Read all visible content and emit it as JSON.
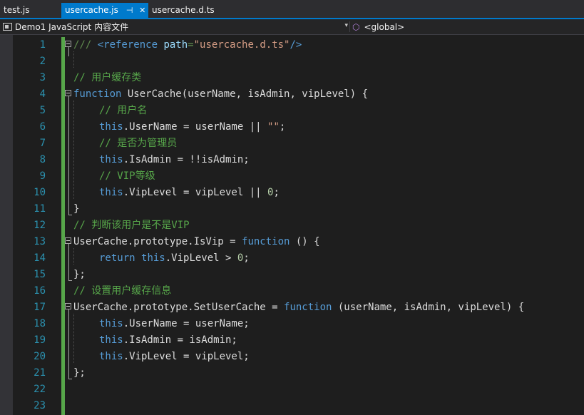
{
  "tabs": [
    {
      "label": "test.js",
      "active": false
    },
    {
      "label": "usercache.js",
      "active": true,
      "pin_icon": "⊣",
      "close_icon": "✕"
    },
    {
      "label": "usercache.d.ts",
      "active": false
    }
  ],
  "navbar": {
    "project": "Demo1 JavaScript 内容文件",
    "scope": "<global>"
  },
  "editor": {
    "line_numbers": [
      "1",
      "2",
      "3",
      "4",
      "5",
      "6",
      "7",
      "8",
      "9",
      "10",
      "11",
      "12",
      "13",
      "14",
      "15",
      "16",
      "17",
      "18",
      "19",
      "20",
      "21",
      "22",
      "23"
    ],
    "l1": {
      "a": "/// ",
      "b": "<reference",
      "c": " path",
      "d": "=",
      "e": "\"usercache.d.ts\"",
      "f": "/>"
    },
    "l3": "// 用户缓存类",
    "l4": {
      "kw": "function",
      "rest": " UserCache(userName, isAdmin, vipLevel) {"
    },
    "l5": "// 用户名",
    "l6": {
      "kw": "this",
      "mid": ".UserName = userName || ",
      "str": "\"\"",
      "end": ";"
    },
    "l7": "// 是否为管理员",
    "l8": {
      "kw": "this",
      "rest": ".IsAdmin = !!isAdmin;"
    },
    "l9": "// VIP等级",
    "l10": {
      "kw": "this",
      "mid": ".VipLevel = vipLevel || ",
      "num": "0",
      "end": ";"
    },
    "l11": "}",
    "l12": "// 判断该用户是不是VIP",
    "l13": {
      "pre": "UserCache.prototype.IsVip = ",
      "kw": "function",
      "rest": " () {"
    },
    "l14": {
      "kw1": "return",
      "sp": " ",
      "kw2": "this",
      "mid": ".VipLevel > ",
      "num": "0",
      "end": ";"
    },
    "l15": "};",
    "l16": "// 设置用户缓存信息",
    "l17": {
      "pre": "UserCache.prototype.SetUserCache = ",
      "kw": "function",
      "rest": " (userName, isAdmin, vipLevel) {"
    },
    "l18": {
      "kw": "this",
      "rest": ".UserName = userName;"
    },
    "l19": {
      "kw": "this",
      "rest": ".IsAdmin = isAdmin;"
    },
    "l20": {
      "kw": "this",
      "rest": ".VipLevel = vipLevel;"
    },
    "l21": "};"
  }
}
